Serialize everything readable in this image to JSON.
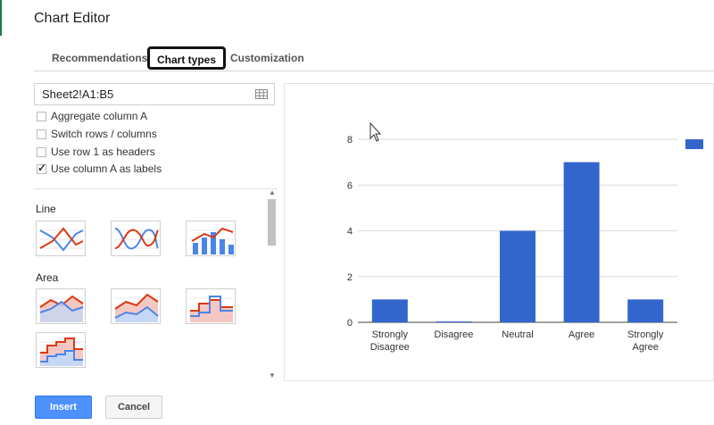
{
  "dialog": {
    "title": "Chart Editor"
  },
  "tabs": [
    {
      "label": "Recommendations"
    },
    {
      "label": "Chart types",
      "selected": true
    },
    {
      "label": "Customization"
    }
  ],
  "data_range": {
    "value": "Sheet2!A1:B5"
  },
  "options": [
    {
      "label": "Aggregate column A",
      "checked": false
    },
    {
      "label": "Switch rows / columns",
      "checked": false
    },
    {
      "label": "Use row 1 as headers",
      "checked": false
    },
    {
      "label": "Use column A as labels",
      "checked": true
    }
  ],
  "sections": [
    {
      "label": "Line",
      "thumbnails": [
        "line-chart-icon",
        "smooth-line-chart-icon",
        "combo-chart-icon"
      ]
    },
    {
      "label": "Area",
      "thumbnails": [
        "area-chart-icon",
        "stacked-area-chart-icon",
        "stepped-area-chart-icon",
        "stacked-stepped-area-chart-icon"
      ]
    }
  ],
  "buttons": {
    "insert": "Insert",
    "cancel": "Cancel"
  },
  "colors": {
    "accent": "#4d90fe",
    "bar": "#3366cc",
    "red": "#dc3912"
  },
  "chart_data": {
    "type": "bar",
    "categories": [
      "Strongly Disagree",
      "Disagree",
      "Neutral",
      "Agree",
      "Strongly Agree"
    ],
    "values": [
      1,
      0,
      4,
      7,
      1
    ],
    "ylim": [
      0,
      8
    ],
    "yticks": [
      "0",
      "2",
      "4",
      "6",
      "8"
    ],
    "grid": true,
    "legend": "top-right"
  }
}
